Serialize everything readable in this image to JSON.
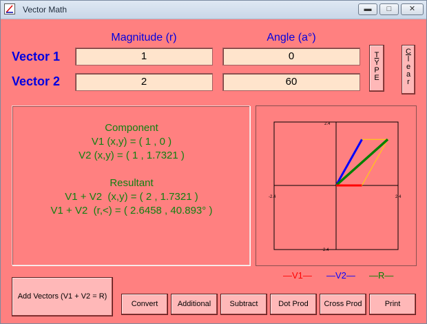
{
  "window": {
    "title": "Vector Math"
  },
  "headers": {
    "magnitude": "Magnitude (r)",
    "angle": "Angle (a°)"
  },
  "vectors": [
    {
      "label": "Vector 1",
      "magnitude": "1",
      "angle": "0"
    },
    {
      "label": "Vector 2",
      "magnitude": "2",
      "angle": "60"
    }
  ],
  "side_buttons": {
    "type_label": "TYPE",
    "clear_label": "Clear"
  },
  "results": {
    "component_title": "Component",
    "v1_xy": "V1 (x,y) = ( 1 , 0 )",
    "v2_xy": "V2 (x,y) = ( 1 , 1.7321 )",
    "resultant_title": "Resultant",
    "sum_xy": "V1 + V2  (x,y) = ( 2 , 1.7321 )",
    "sum_polar": "V1 + V2  (r,<) = ( 2.6458 , 40.893° )"
  },
  "graph": {
    "top_tick": "2.4",
    "bottom_tick": "-2.4",
    "left_tick": "-2.4",
    "right_tick": "2.4",
    "range": 2.4,
    "v1": [
      1,
      0
    ],
    "v2": [
      1,
      1.7321
    ],
    "resultant": [
      2,
      1.7321
    ],
    "colors": {
      "v1": "#ff0000",
      "v2": "#0000ff",
      "resultant": "#008000",
      "parallelogram": "#ffd700"
    }
  },
  "legend": {
    "v1": "—V1—",
    "v2": "—V2—",
    "r": "—R—"
  },
  "buttons": {
    "add": "Add Vectors (V1 + V2 = R)",
    "convert": "Convert",
    "additional": "Additional",
    "subtract": "Subtract",
    "dot": "Dot Prod",
    "cross": "Cross Prod",
    "print": "Print"
  }
}
